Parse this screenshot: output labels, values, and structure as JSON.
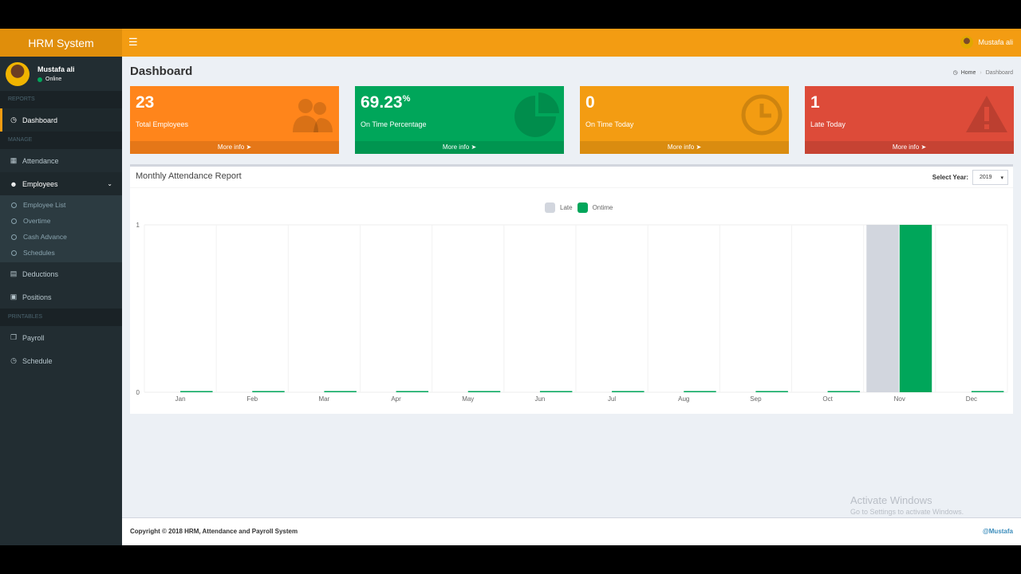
{
  "app": {
    "logo": "HRM System"
  },
  "topbar": {
    "menu_icon": "bars-icon",
    "username": "Mustafa ali"
  },
  "user": {
    "name": "Mustafa ali",
    "status": "Online"
  },
  "sidebar": {
    "sections": [
      "REPORTS",
      "MANAGE",
      "PRINTABLES"
    ],
    "items": [
      {
        "label": "Dashboard",
        "icon": "dashboard-icon"
      },
      {
        "label": "Attendance",
        "icon": "calendar-icon"
      },
      {
        "label": "Employees",
        "icon": "users-icon"
      },
      {
        "label": "Deductions",
        "icon": "file-icon"
      },
      {
        "label": "Positions",
        "icon": "suitcase-icon"
      },
      {
        "label": "Payroll",
        "icon": "files-icon"
      },
      {
        "label": "Schedule",
        "icon": "clock-icon"
      }
    ],
    "submenu": [
      "Employee List",
      "Overtime",
      "Cash Advance",
      "Schedules"
    ]
  },
  "page": {
    "title": "Dashboard"
  },
  "breadcrumb": {
    "home": "Home",
    "current": "Dashboard"
  },
  "boxes": [
    {
      "value": "23",
      "suffix": "",
      "label": "Total Employees",
      "footer": "More info",
      "icon": "users-icon",
      "color": "#ff851b"
    },
    {
      "value": "69.23",
      "suffix": "%",
      "label": "On Time Percentage",
      "footer": "More info",
      "icon": "pie-chart-icon",
      "color": "#00a65a"
    },
    {
      "value": "0",
      "suffix": "",
      "label": "On Time Today",
      "footer": "More info",
      "icon": "clock-icon",
      "color": "#f39c12"
    },
    {
      "value": "1",
      "suffix": "",
      "label": "Late Today",
      "footer": "More info",
      "icon": "warning-icon",
      "color": "#dd4b39"
    }
  ],
  "chart_box": {
    "title": "Monthly Attendance Report",
    "select_label": "Select Year:",
    "year": "2019"
  },
  "chart_data": {
    "type": "bar",
    "categories": [
      "Jan",
      "Feb",
      "Mar",
      "Apr",
      "May",
      "Jun",
      "Jul",
      "Aug",
      "Sep",
      "Oct",
      "Nov",
      "Dec"
    ],
    "series": [
      {
        "name": "Late",
        "color": "#d2d6de",
        "values": [
          0,
          0,
          0,
          0,
          0,
          0,
          0,
          0,
          0,
          0,
          1,
          0
        ]
      },
      {
        "name": "Ontime",
        "color": "#00a65a",
        "values": [
          0,
          0,
          0,
          0,
          0,
          0,
          0,
          0,
          0,
          0,
          1,
          0
        ]
      }
    ],
    "ylim": [
      0,
      1
    ],
    "yticks": [
      "0",
      "1"
    ],
    "legend": "top-center",
    "grid": true
  },
  "watermark": {
    "line1": "Activate Windows",
    "line2": "Go to Settings to activate Windows."
  },
  "footer": {
    "copyright": "Copyright © 2018 HRM, Attendance and Payroll System",
    "author": "@Mustafa"
  }
}
